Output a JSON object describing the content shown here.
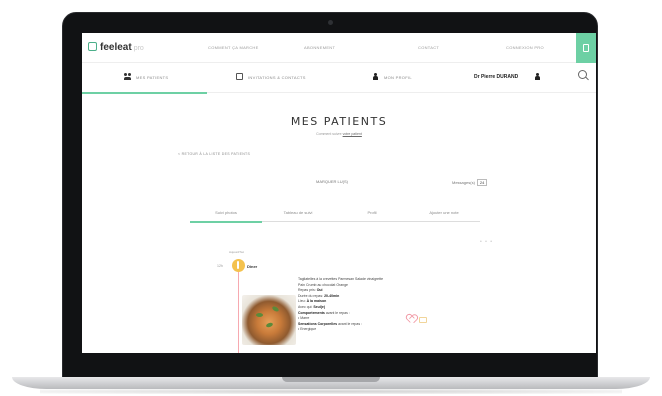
{
  "app": {
    "logo_text": "feeleat",
    "logo_suffix": "pro"
  },
  "topnav": {
    "links": [
      "Comment ça marche",
      "Abonnement",
      "Contact",
      "Connexion pro"
    ]
  },
  "subnav": {
    "patients": "Mes patients",
    "invitations": "Invitations & contacts",
    "profile": "Mon profil",
    "doctor": "Dr Pierre DURAND"
  },
  "page": {
    "title": "MES PATIENTS",
    "breadcrumb_prefix": "Comment suivre",
    "breadcrumb_link": "votre patient",
    "back_link": "< Retour à la liste des patients",
    "mark_read": "Marquer lu(s)",
    "messages_label": "Messages(s)",
    "messages_count": "24"
  },
  "tabs": [
    "Suivi photos",
    "Tableau de suivi",
    "Profil",
    "Ajouter une note"
  ],
  "timeline": {
    "day": "Aujourd'hui",
    "time": "12h",
    "meal": "Dîner"
  },
  "meal": {
    "line1": "Tagliatelles à la crevettes Parmesan Salade vinaigrette",
    "line2": "Pain Crumb au chocolat Orange",
    "repas_label": "Repas pris:",
    "repas_value": "Oui",
    "duree_label": "Durée du repas:",
    "duree_value": "20-40min",
    "lieu_label": "Lieu:",
    "lieu_value": "À la maison",
    "avec_label": "Avec qui:",
    "avec_value": "Seul(e)",
    "comport_label": "Comportements",
    "comport_suffix": "avant le repas :",
    "comport_item": "•  Marre",
    "sens_label": "Sensations Corporelles",
    "sens_suffix": "avant le repas :",
    "sens_item": "•  Energique"
  },
  "colors": {
    "accent": "#6dd0a4",
    "timeline": "#f7a9b0",
    "marker": "#f4c24e"
  }
}
